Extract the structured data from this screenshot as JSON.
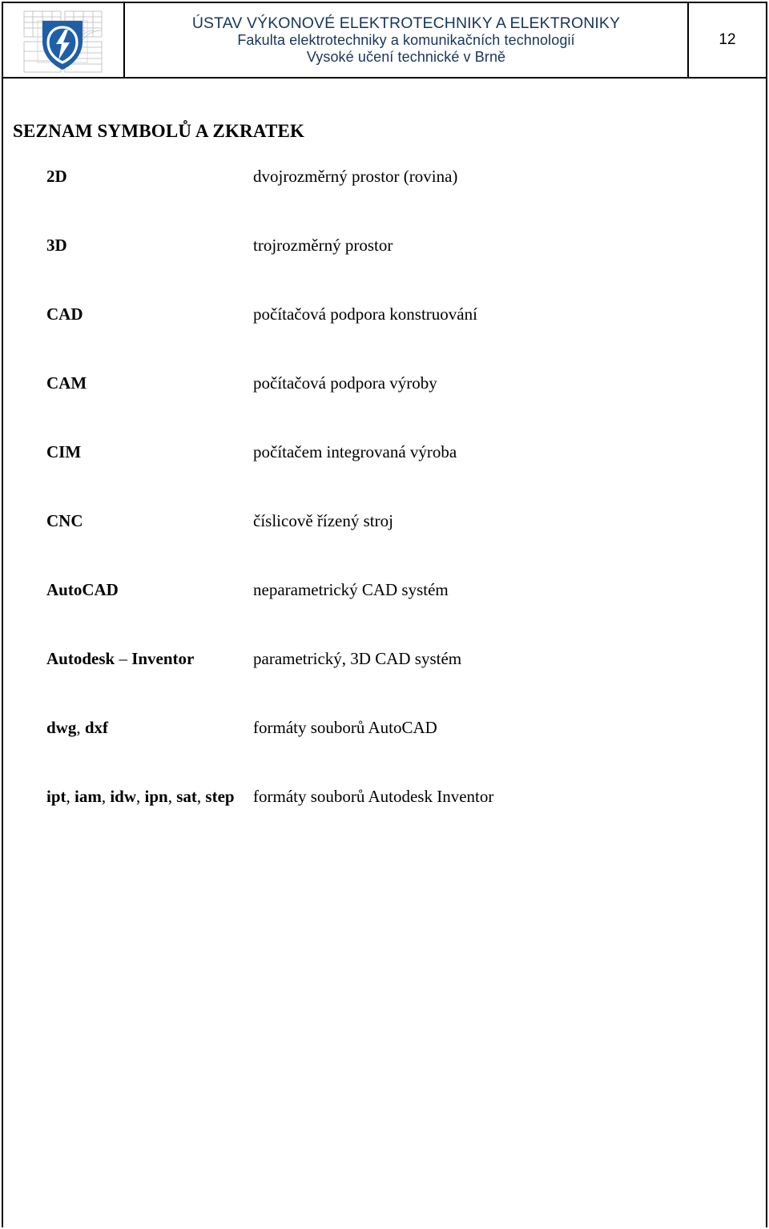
{
  "header": {
    "institute_line": "ÚSTAV VÝKONOVÉ ELEKTROTECHNIKY A ELEKTRONIKY",
    "faculty_line": "Fakulta elektrotechniky a komunikačních technologií",
    "university_line": "Vysoké učení technické v Brně",
    "page_number": "12",
    "logo_name": "vut-feec-shield-logo",
    "title_color": "#16365c",
    "logo_color": "#1f5fa8",
    "border_color": "#000000"
  },
  "body": {
    "section_title": "SEZNAM SYMBOLŮ A ZKRATEK",
    "entries": [
      {
        "term": "2D",
        "definition": "dvojrozměrný prostor (rovina)"
      },
      {
        "term": "3D",
        "definition": "trojrozměrný prostor"
      },
      {
        "term": "CAD",
        "definition": "počítačová podpora konstruování"
      },
      {
        "term": "CAM",
        "definition": "počítačová podpora výroby"
      },
      {
        "term": "CIM",
        "definition": "počítačem integrovaná výroba"
      },
      {
        "term": "CNC",
        "definition": "číslicově řízený stroj"
      },
      {
        "term": "AutoCAD",
        "definition": "neparametrický CAD systém"
      },
      {
        "term": "Autodesk – Inventor",
        "definition": "parametrický, 3D CAD systém"
      },
      {
        "term": "dwg, dxf",
        "definition": "formáty souborů AutoCAD"
      },
      {
        "term": "ipt, iam, idw, ipn, sat, step",
        "definition": "formáty souborů Autodesk Inventor"
      }
    ]
  }
}
